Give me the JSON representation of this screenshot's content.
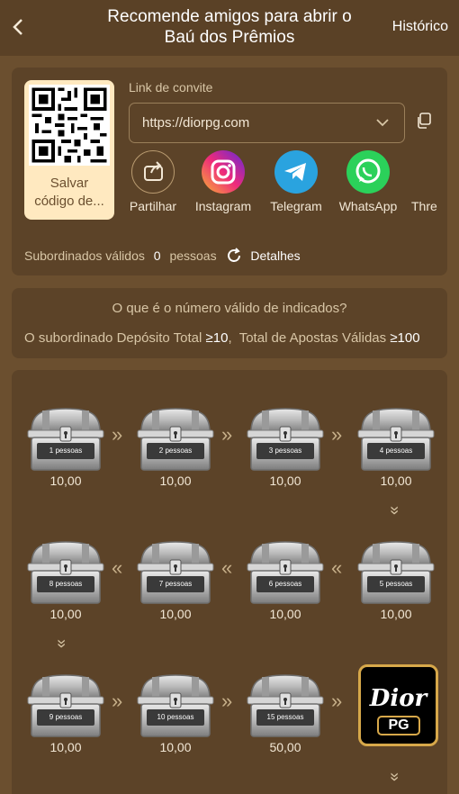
{
  "header": {
    "back_icon": "chevron-left-icon",
    "title_line1": "Recomende amigos para abrir o",
    "title_line2": "Baú dos Prêmios",
    "history": "Histórico"
  },
  "invite": {
    "qr_caption_line1": "Salvar",
    "qr_caption_line2": "código de...",
    "link_label": "Link de convite",
    "link_value": "https://diorpg.com",
    "share_items": [
      {
        "label": "Partilhar",
        "icon": "share-icon"
      },
      {
        "label": "Instagram",
        "icon": "instagram-icon"
      },
      {
        "label": "Telegram",
        "icon": "telegram-icon"
      },
      {
        "label": "WhatsApp",
        "icon": "whatsapp-icon"
      },
      {
        "label": "Thre",
        "icon": "threads-icon"
      }
    ],
    "valid_label": "Subordinados válidos",
    "valid_count": "0",
    "valid_unit": "pessoas",
    "details": "Detalhes"
  },
  "rules": {
    "question": "O que é o número válido de indicados?",
    "deposit_label": "O subordinado Depósito Total",
    "deposit_value": "≥10",
    "sep": ",",
    "bets_label": "Total de Apostas Válidas",
    "bets_value": "≥100"
  },
  "chests": [
    {
      "people": "1 pessoas",
      "amount": "10,00"
    },
    {
      "people": "2 pessoas",
      "amount": "10,00"
    },
    {
      "people": "3 pessoas",
      "amount": "10,00"
    },
    {
      "people": "4 pessoas",
      "amount": "10,00"
    },
    {
      "people": "5 pessoas",
      "amount": "10,00"
    },
    {
      "people": "6 pessoas",
      "amount": "10,00"
    },
    {
      "people": "7 pessoas",
      "amount": "10,00"
    },
    {
      "people": "8 pessoas",
      "amount": "10,00"
    },
    {
      "people": "9 pessoas",
      "amount": "10,00"
    },
    {
      "people": "10 pessoas",
      "amount": "10,00"
    },
    {
      "people": "15 pessoas",
      "amount": "50,00"
    }
  ],
  "logo": {
    "line1": "Dior",
    "line2": "PG"
  },
  "colors": {
    "background": "#6b4f2f",
    "card": "#5c4328",
    "accent": "#ffe9c0"
  }
}
